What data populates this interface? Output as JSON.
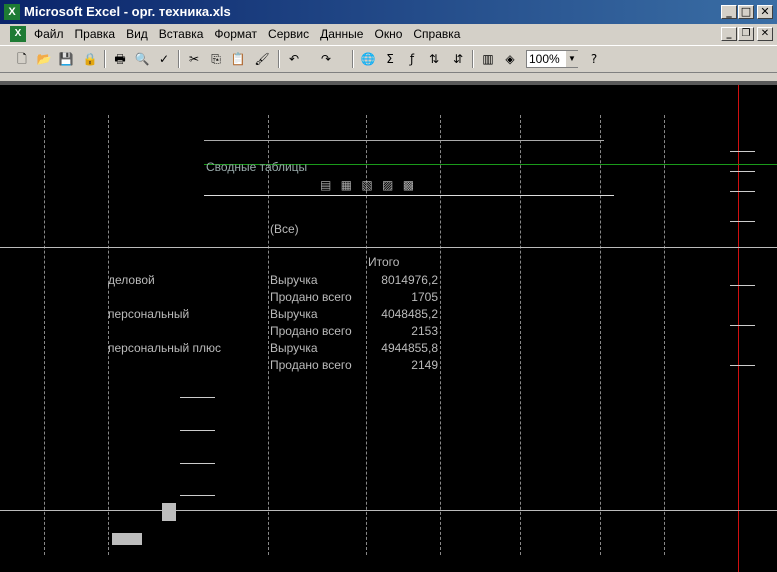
{
  "window": {
    "app_icon": "excel-icon",
    "title": "Microsoft Excel - орг. техника.xls",
    "controls": {
      "minimize": "_",
      "maximize": "□",
      "close": "✕"
    }
  },
  "menu": {
    "items": [
      "Файл",
      "Правка",
      "Вид",
      "Вставка",
      "Формат",
      "Сервис",
      "Данные",
      "Окно",
      "Справка"
    ]
  },
  "toolbar": {
    "zoom_value": "100%",
    "icons": [
      "new-icon",
      "open-icon",
      "save-icon",
      "permission-icon",
      "print-icon",
      "print-preview-icon",
      "spelling-icon",
      "cut-icon",
      "copy-icon",
      "paste-icon",
      "format-painter-icon",
      "undo-icon",
      "redo-icon",
      "hyperlink-icon",
      "autosum-icon",
      "function-icon",
      "sort-ascending-icon",
      "sort-descending-icon",
      "chart-wizard-icon",
      "drawing-icon",
      "help-icon"
    ]
  },
  "pivot": {
    "toolbar_title": "Сводные таблицы",
    "page_field_value": "(Все)",
    "data_header": "Итого",
    "rows": [
      {
        "category": "деловой",
        "measure": "Выручка",
        "value": "8014976,2"
      },
      {
        "category": "",
        "measure": "Продано всего",
        "value": "1705"
      },
      {
        "category": "персональный",
        "measure": "Выручка",
        "value": "4048485,2"
      },
      {
        "category": "",
        "measure": "Продано всего",
        "value": "2153"
      },
      {
        "category": "персональный плюс",
        "measure": "Выручка",
        "value": "4944855,8"
      },
      {
        "category": "",
        "measure": "Продано всего",
        "value": "2149"
      }
    ]
  },
  "colors": {
    "title_start": "#0a246a",
    "title_end": "#3a6ea5",
    "chrome": "#d4d0c8"
  }
}
